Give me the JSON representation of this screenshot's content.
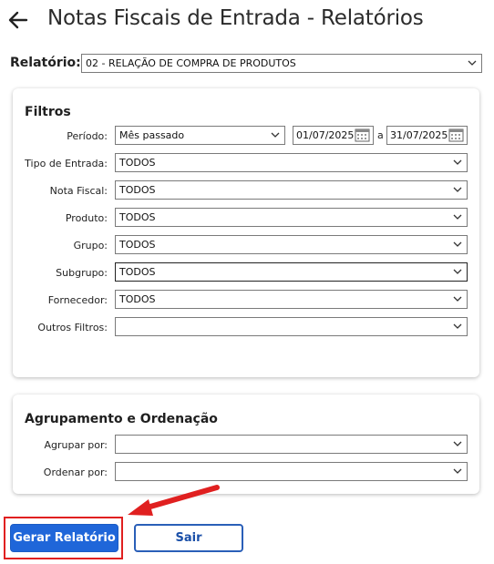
{
  "header": {
    "title": "Notas Fiscais de Entrada - Relatórios",
    "back_icon": "arrow-left-icon"
  },
  "relatorio": {
    "label": "Relatório:",
    "value": "02 - RELAÇÃO DE COMPRA DE PRODUTOS"
  },
  "filtros": {
    "title": "Filtros",
    "periodo": {
      "label": "Período:",
      "value": "Mês passado",
      "date_from": "01/07/2025",
      "date_sep": "a",
      "date_to": "31/07/2025"
    },
    "fields": [
      {
        "label": "Tipo de Entrada:",
        "value": "TODOS"
      },
      {
        "label": "Nota Fiscal:",
        "value": "TODOS"
      },
      {
        "label": "Produto:",
        "value": "TODOS"
      },
      {
        "label": "Grupo:",
        "value": "TODOS"
      },
      {
        "label": "Subgrupo:",
        "value": "TODOS"
      },
      {
        "label": "Fornecedor:",
        "value": "TODOS"
      },
      {
        "label": "Outros Filtros:",
        "value": ""
      }
    ]
  },
  "agrupamento": {
    "title": "Agrupamento e Ordenação",
    "agrupar": {
      "label": "Agrupar por:",
      "value": ""
    },
    "ordenar": {
      "label": "Ordenar por:",
      "value": ""
    }
  },
  "actions": {
    "generate_label": "Gerar Relatório",
    "exit_label": "Sair"
  },
  "colors": {
    "primary": "#1f66d9",
    "highlight": "#e02020"
  }
}
